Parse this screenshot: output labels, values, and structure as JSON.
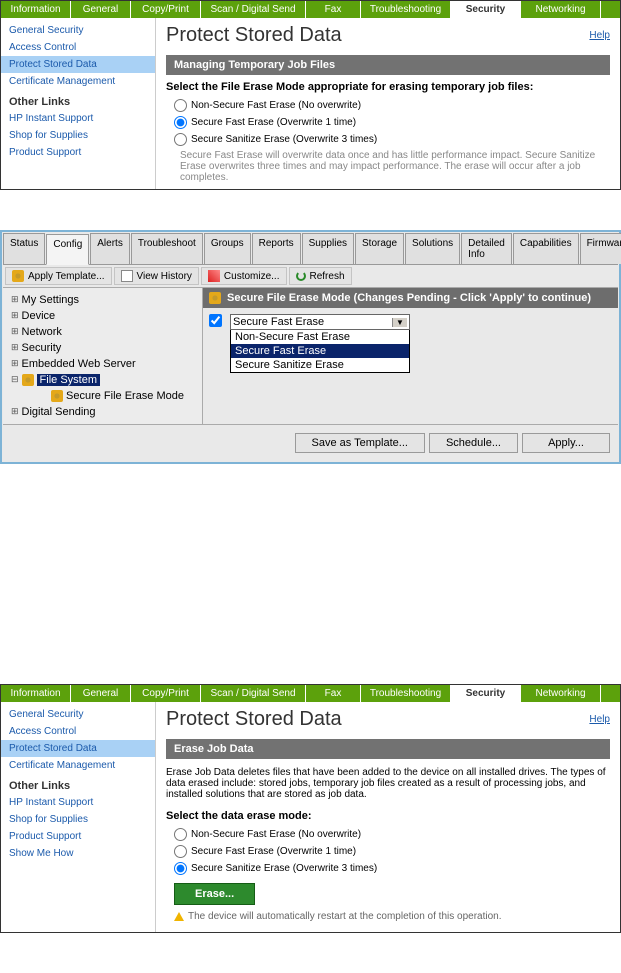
{
  "panel1": {
    "tabs": [
      "Information",
      "General",
      "Copy/Print",
      "Scan / Digital Send",
      "Fax",
      "Troubleshooting",
      "Security",
      "Networking"
    ],
    "active_tab": "Security",
    "sidebar": {
      "items": [
        "General Security",
        "Access Control",
        "Protect Stored Data",
        "Certificate Management"
      ],
      "active": "Protect Stored Data",
      "other_hdr": "Other Links",
      "other": [
        "HP Instant Support",
        "Shop for Supplies",
        "Product Support"
      ]
    },
    "title": "Protect Stored Data",
    "help": "Help",
    "section": "Managing Temporary Job Files",
    "instruction": "Select the File Erase Mode appropriate for erasing temporary job files:",
    "radios": [
      {
        "label": "Non-Secure Fast Erase (No overwrite)",
        "checked": false
      },
      {
        "label": "Secure Fast Erase (Overwrite 1 time)",
        "checked": true
      },
      {
        "label": "Secure Sanitize Erase (Overwrite 3 times)",
        "checked": false
      }
    ],
    "note": "Secure Fast Erase will overwrite data once and has little performance impact. Secure Sanitize Erase overwrites three times and may impact performance. The erase will occur after a job completes."
  },
  "panel2": {
    "tabs": [
      "Status",
      "Config",
      "Alerts",
      "Troubleshoot",
      "Groups",
      "Reports",
      "Supplies",
      "Storage",
      "Solutions",
      "Detailed Info",
      "Capabilities",
      "Firmware"
    ],
    "active_tab": "Config",
    "toolbar": {
      "apply": "Apply Template...",
      "history": "View History",
      "customize": "Customize...",
      "refresh": "Refresh"
    },
    "tree": [
      "My Settings",
      "Device",
      "Network",
      "Security",
      "Embedded Web Server",
      "File System",
      "Secure File Erase Mode",
      "Digital Sending"
    ],
    "tree_selected": "File System",
    "header": "Secure File Erase Mode  (Changes Pending - Click 'Apply' to continue)",
    "dd_selected": "Secure Fast Erase",
    "dd_options": [
      "Non-Secure Fast Erase",
      "Secure Fast Erase",
      "Secure Sanitize Erase"
    ],
    "footer": {
      "save": "Save as Template...",
      "schedule": "Schedule...",
      "apply": "Apply..."
    }
  },
  "panel3": {
    "tabs": [
      "Information",
      "General",
      "Copy/Print",
      "Scan / Digital Send",
      "Fax",
      "Troubleshooting",
      "Security",
      "Networking"
    ],
    "active_tab": "Security",
    "sidebar": {
      "items": [
        "General Security",
        "Access Control",
        "Protect Stored Data",
        "Certificate Management"
      ],
      "active": "Protect Stored Data",
      "other_hdr": "Other Links",
      "other": [
        "HP Instant Support",
        "Shop for Supplies",
        "Product Support",
        "Show Me How"
      ]
    },
    "title": "Protect Stored Data",
    "help": "Help",
    "section": "Erase Job Data",
    "intro": "Erase Job Data deletes files that have been added to the device on all installed drives. The types of data erased include: stored jobs, temporary job files created as a result of processing jobs, and installed solutions that are stored as job data.",
    "instruction": "Select the data erase mode:",
    "radios": [
      {
        "label": "Non-Secure Fast Erase (No overwrite)",
        "checked": false
      },
      {
        "label": "Secure Fast Erase (Overwrite 1 time)",
        "checked": false
      },
      {
        "label": "Secure Sanitize Erase (Overwrite 3 times)",
        "checked": true
      }
    ],
    "erase_btn": "Erase...",
    "warn": "The device will automatically restart at the completion of this operation."
  }
}
